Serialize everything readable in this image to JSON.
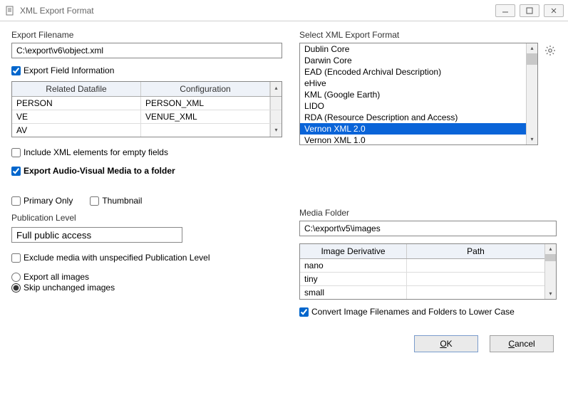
{
  "window": {
    "title": "XML Export Format"
  },
  "left": {
    "filename_label": "Export Filename",
    "filename_value": "C:\\export\\v6\\object.xml",
    "export_field_info_label": "Export Field Information",
    "datafile_head_1": "Related Datafile",
    "datafile_head_2": "Configuration",
    "datafile_rows": [
      {
        "a": "PERSON",
        "b": "PERSON_XML"
      },
      {
        "a": "VE",
        "b": "VENUE_XML"
      },
      {
        "a": "AV",
        "b": ""
      }
    ],
    "include_empty_label": "Include XML elements for empty fields",
    "export_av_label": "Export Audio-Visual Media to a folder",
    "primary_only_label": "Primary Only",
    "thumbnail_label": "Thumbnail",
    "pub_level_label": "Publication Level",
    "pub_level_value": "Full public access",
    "exclude_unspec_label": "Exclude media with unspecified Publication Level",
    "export_all_label": "Export all images",
    "skip_unchanged_label": "Skip unchanged images"
  },
  "right": {
    "select_format_label": "Select XML Export Format",
    "formats": {
      "f0": "Dublin Core",
      "f1": "Darwin Core",
      "f2": "EAD (Encoded Archival Description)",
      "f3": "eHive",
      "f4": "KML (Google Earth)",
      "f5": "LIDO",
      "f6": "RDA (Resource Description and Access)",
      "f7": "Vernon XML 2.0",
      "f8": "Vernon XML 1.0"
    },
    "media_folder_label": "Media Folder",
    "media_folder_value": "C:\\export\\v5\\images",
    "deriv_head_1": "Image Derivative",
    "deriv_head_2": "Path",
    "deriv_rows": {
      "r0": "nano",
      "r1": "tiny",
      "r2": "small"
    },
    "convert_lower_label": "Convert Image Filenames and Folders to Lower Case"
  },
  "footer": {
    "ok": "K",
    "ok_pre": "O",
    "cancel": "ancel",
    "cancel_pre": "C"
  }
}
